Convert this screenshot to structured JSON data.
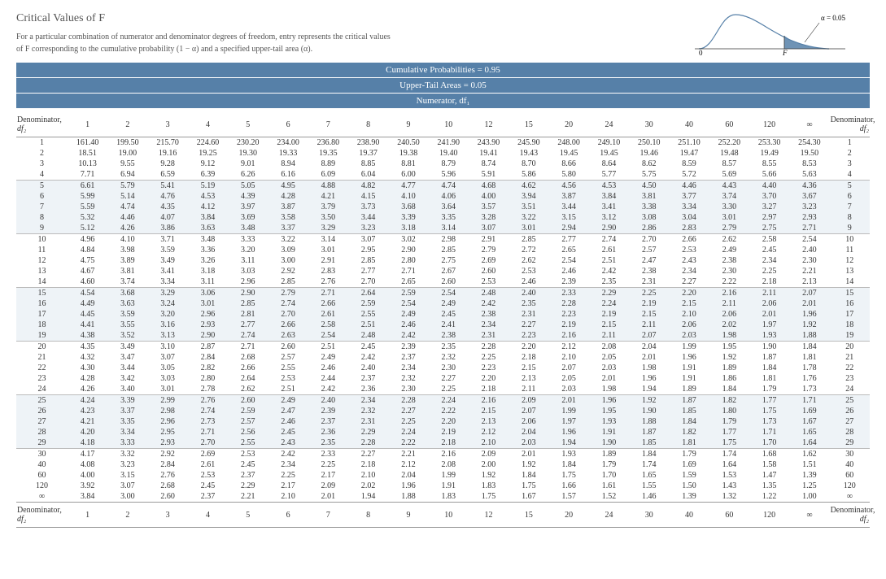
{
  "title": "Critical Values of F",
  "sub1": "For a particular combination of numerator and denominator degrees of freedom, entry represents the critical values",
  "sub2": "of F corresponding to the cumulative probability (1 − α) and a specified upper-tail area (α).",
  "alpha_lbl": "α = 0.05",
  "axis0": "0",
  "axisF": "F",
  "banner1": "Cumulative Probabilities = 0.95",
  "banner2": "Upper-Tail Areas = 0.05",
  "banner3": "Numerator, df₁",
  "denom_lbl": "Denominator,",
  "df2_lbl": "df₂",
  "cols": [
    "1",
    "2",
    "3",
    "4",
    "5",
    "6",
    "7",
    "8",
    "9",
    "10",
    "12",
    "15",
    "20",
    "24",
    "30",
    "40",
    "60",
    "120",
    "∞"
  ],
  "chart_data": {
    "type": "table",
    "title": "Critical Values of F, Cumulative Probabilities = 0.95, Upper-Tail Areas = 0.05",
    "xlabel": "Numerator df₁",
    "ylabel": "Denominator df₂",
    "col_headers": [
      "1",
      "2",
      "3",
      "4",
      "5",
      "6",
      "7",
      "8",
      "9",
      "10",
      "12",
      "15",
      "20",
      "24",
      "30",
      "40",
      "60",
      "120",
      "∞"
    ],
    "rows": [
      {
        "df2": "1",
        "v": [
          "161.40",
          "199.50",
          "215.70",
          "224.60",
          "230.20",
          "234.00",
          "236.80",
          "238.90",
          "240.50",
          "241.90",
          "243.90",
          "245.90",
          "248.00",
          "249.10",
          "250.10",
          "251.10",
          "252.20",
          "253.30",
          "254.30"
        ]
      },
      {
        "df2": "2",
        "v": [
          "18.51",
          "19.00",
          "19.16",
          "19.25",
          "19.30",
          "19.33",
          "19.35",
          "19.37",
          "19.38",
          "19.40",
          "19.41",
          "19.43",
          "19.45",
          "19.45",
          "19.46",
          "19.47",
          "19.48",
          "19.49",
          "19.50"
        ]
      },
      {
        "df2": "3",
        "v": [
          "10.13",
          "9.55",
          "9.28",
          "9.12",
          "9.01",
          "8.94",
          "8.89",
          "8.85",
          "8.81",
          "8.79",
          "8.74",
          "8.70",
          "8.66",
          "8.64",
          "8.62",
          "8.59",
          "8.57",
          "8.55",
          "8.53"
        ]
      },
      {
        "df2": "4",
        "v": [
          "7.71",
          "6.94",
          "6.59",
          "6.39",
          "6.26",
          "6.16",
          "6.09",
          "6.04",
          "6.00",
          "5.96",
          "5.91",
          "5.86",
          "5.80",
          "5.77",
          "5.75",
          "5.72",
          "5.69",
          "5.66",
          "5.63"
        ]
      },
      {
        "df2": "5",
        "v": [
          "6.61",
          "5.79",
          "5.41",
          "5.19",
          "5.05",
          "4.95",
          "4.88",
          "4.82",
          "4.77",
          "4.74",
          "4.68",
          "4.62",
          "4.56",
          "4.53",
          "4.50",
          "4.46",
          "4.43",
          "4.40",
          "4.36"
        ]
      },
      {
        "df2": "6",
        "v": [
          "5.99",
          "5.14",
          "4.76",
          "4.53",
          "4.39",
          "4.28",
          "4.21",
          "4.15",
          "4.10",
          "4.06",
          "4.00",
          "3.94",
          "3.87",
          "3.84",
          "3.81",
          "3.77",
          "3.74",
          "3.70",
          "3.67"
        ]
      },
      {
        "df2": "7",
        "v": [
          "5.59",
          "4.74",
          "4.35",
          "4.12",
          "3.97",
          "3.87",
          "3.79",
          "3.73",
          "3.68",
          "3.64",
          "3.57",
          "3.51",
          "3.44",
          "3.41",
          "3.38",
          "3.34",
          "3.30",
          "3.27",
          "3.23"
        ]
      },
      {
        "df2": "8",
        "v": [
          "5.32",
          "4.46",
          "4.07",
          "3.84",
          "3.69",
          "3.58",
          "3.50",
          "3.44",
          "3.39",
          "3.35",
          "3.28",
          "3.22",
          "3.15",
          "3.12",
          "3.08",
          "3.04",
          "3.01",
          "2.97",
          "2.93"
        ]
      },
      {
        "df2": "9",
        "v": [
          "5.12",
          "4.26",
          "3.86",
          "3.63",
          "3.48",
          "3.37",
          "3.29",
          "3.23",
          "3.18",
          "3.14",
          "3.07",
          "3.01",
          "2.94",
          "2.90",
          "2.86",
          "2.83",
          "2.79",
          "2.75",
          "2.71"
        ]
      },
      {
        "df2": "10",
        "v": [
          "4.96",
          "4.10",
          "3.71",
          "3.48",
          "3.33",
          "3.22",
          "3.14",
          "3.07",
          "3.02",
          "2.98",
          "2.91",
          "2.85",
          "2.77",
          "2.74",
          "2.70",
          "2.66",
          "2.62",
          "2.58",
          "2.54"
        ]
      },
      {
        "df2": "11",
        "v": [
          "4.84",
          "3.98",
          "3.59",
          "3.36",
          "3.20",
          "3.09",
          "3.01",
          "2.95",
          "2.90",
          "2.85",
          "2.79",
          "2.72",
          "2.65",
          "2.61",
          "2.57",
          "2.53",
          "2.49",
          "2.45",
          "2.40"
        ]
      },
      {
        "df2": "12",
        "v": [
          "4.75",
          "3.89",
          "3.49",
          "3.26",
          "3.11",
          "3.00",
          "2.91",
          "2.85",
          "2.80",
          "2.75",
          "2.69",
          "2.62",
          "2.54",
          "2.51",
          "2.47",
          "2.43",
          "2.38",
          "2.34",
          "2.30"
        ]
      },
      {
        "df2": "13",
        "v": [
          "4.67",
          "3.81",
          "3.41",
          "3.18",
          "3.03",
          "2.92",
          "2.83",
          "2.77",
          "2.71",
          "2.67",
          "2.60",
          "2.53",
          "2.46",
          "2.42",
          "2.38",
          "2.34",
          "2.30",
          "2.25",
          "2.21"
        ]
      },
      {
        "df2": "14",
        "v": [
          "4.60",
          "3.74",
          "3.34",
          "3.11",
          "2.96",
          "2.85",
          "2.76",
          "2.70",
          "2.65",
          "2.60",
          "2.53",
          "2.46",
          "2.39",
          "2.35",
          "2.31",
          "2.27",
          "2.22",
          "2.18",
          "2.13"
        ]
      },
      {
        "df2": "15",
        "v": [
          "4.54",
          "3.68",
          "3.29",
          "3.06",
          "2.90",
          "2.79",
          "2.71",
          "2.64",
          "2.59",
          "2.54",
          "2.48",
          "2.40",
          "2.33",
          "2.29",
          "2.25",
          "2.20",
          "2.16",
          "2.11",
          "2.07"
        ]
      },
      {
        "df2": "16",
        "v": [
          "4.49",
          "3.63",
          "3.24",
          "3.01",
          "2.85",
          "2.74",
          "2.66",
          "2.59",
          "2.54",
          "2.49",
          "2.42",
          "2.35",
          "2.28",
          "2.24",
          "2.19",
          "2.15",
          "2.11",
          "2.06",
          "2.01"
        ]
      },
      {
        "df2": "17",
        "v": [
          "4.45",
          "3.59",
          "3.20",
          "2.96",
          "2.81",
          "2.70",
          "2.61",
          "2.55",
          "2.49",
          "2.45",
          "2.38",
          "2.31",
          "2.23",
          "2.19",
          "2.15",
          "2.10",
          "2.06",
          "2.01",
          "1.96"
        ]
      },
      {
        "df2": "18",
        "v": [
          "4.41",
          "3.55",
          "3.16",
          "2.93",
          "2.77",
          "2.66",
          "2.58",
          "2.51",
          "2.46",
          "2.41",
          "2.34",
          "2.27",
          "2.19",
          "2.15",
          "2.11",
          "2.06",
          "2.02",
          "1.97",
          "1.92"
        ]
      },
      {
        "df2": "19",
        "v": [
          "4.38",
          "3.52",
          "3.13",
          "2.90",
          "2.74",
          "2.63",
          "2.54",
          "2.48",
          "2.42",
          "2.38",
          "2.31",
          "2.23",
          "2.16",
          "2.11",
          "2.07",
          "2.03",
          "1.98",
          "1.93",
          "1.88"
        ]
      },
      {
        "df2": "20",
        "v": [
          "4.35",
          "3.49",
          "3.10",
          "2.87",
          "2.71",
          "2.60",
          "2.51",
          "2.45",
          "2.39",
          "2.35",
          "2.28",
          "2.20",
          "2.12",
          "2.08",
          "2.04",
          "1.99",
          "1.95",
          "1.90",
          "1.84"
        ]
      },
      {
        "df2": "21",
        "v": [
          "4.32",
          "3.47",
          "3.07",
          "2.84",
          "2.68",
          "2.57",
          "2.49",
          "2.42",
          "2.37",
          "2.32",
          "2.25",
          "2.18",
          "2.10",
          "2.05",
          "2.01",
          "1.96",
          "1.92",
          "1.87",
          "1.81"
        ]
      },
      {
        "df2": "22",
        "v": [
          "4.30",
          "3.44",
          "3.05",
          "2.82",
          "2.66",
          "2.55",
          "2.46",
          "2.40",
          "2.34",
          "2.30",
          "2.23",
          "2.15",
          "2.07",
          "2.03",
          "1.98",
          "1.91",
          "1.89",
          "1.84",
          "1.78"
        ]
      },
      {
        "df2": "23",
        "v": [
          "4.28",
          "3.42",
          "3.03",
          "2.80",
          "2.64",
          "2.53",
          "2.44",
          "2.37",
          "2.32",
          "2.27",
          "2.20",
          "2.13",
          "2.05",
          "2.01",
          "1.96",
          "1.91",
          "1.86",
          "1.81",
          "1.76"
        ]
      },
      {
        "df2": "24",
        "v": [
          "4.26",
          "3.40",
          "3.01",
          "2.78",
          "2.62",
          "2.51",
          "2.42",
          "2.36",
          "2.30",
          "2.25",
          "2.18",
          "2.11",
          "2.03",
          "1.98",
          "1.94",
          "1.89",
          "1.84",
          "1.79",
          "1.73"
        ]
      },
      {
        "df2": "25",
        "v": [
          "4.24",
          "3.39",
          "2.99",
          "2.76",
          "2.60",
          "2.49",
          "2.40",
          "2.34",
          "2.28",
          "2.24",
          "2.16",
          "2.09",
          "2.01",
          "1.96",
          "1.92",
          "1.87",
          "1.82",
          "1.77",
          "1.71"
        ]
      },
      {
        "df2": "26",
        "v": [
          "4.23",
          "3.37",
          "2.98",
          "2.74",
          "2.59",
          "2.47",
          "2.39",
          "2.32",
          "2.27",
          "2.22",
          "2.15",
          "2.07",
          "1.99",
          "1.95",
          "1.90",
          "1.85",
          "1.80",
          "1.75",
          "1.69"
        ]
      },
      {
        "df2": "27",
        "v": [
          "4.21",
          "3.35",
          "2.96",
          "2.73",
          "2.57",
          "2.46",
          "2.37",
          "2.31",
          "2.25",
          "2.20",
          "2.13",
          "2.06",
          "1.97",
          "1.93",
          "1.88",
          "1.84",
          "1.79",
          "1.73",
          "1.67"
        ]
      },
      {
        "df2": "28",
        "v": [
          "4.20",
          "3.34",
          "2.95",
          "2.71",
          "2.56",
          "2.45",
          "2.36",
          "2.29",
          "2.24",
          "2.19",
          "2.12",
          "2.04",
          "1.96",
          "1.91",
          "1.87",
          "1.82",
          "1.77",
          "1.71",
          "1.65"
        ]
      },
      {
        "df2": "29",
        "v": [
          "4.18",
          "3.33",
          "2.93",
          "2.70",
          "2.55",
          "2.43",
          "2.35",
          "2.28",
          "2.22",
          "2.18",
          "2.10",
          "2.03",
          "1.94",
          "1.90",
          "1.85",
          "1.81",
          "1.75",
          "1.70",
          "1.64"
        ]
      },
      {
        "df2": "30",
        "v": [
          "4.17",
          "3.32",
          "2.92",
          "2.69",
          "2.53",
          "2.42",
          "2.33",
          "2.27",
          "2.21",
          "2.16",
          "2.09",
          "2.01",
          "1.93",
          "1.89",
          "1.84",
          "1.79",
          "1.74",
          "1.68",
          "1.62"
        ]
      },
      {
        "df2": "40",
        "v": [
          "4.08",
          "3.23",
          "2.84",
          "2.61",
          "2.45",
          "2.34",
          "2.25",
          "2.18",
          "2.12",
          "2.08",
          "2.00",
          "1.92",
          "1.84",
          "1.79",
          "1.74",
          "1.69",
          "1.64",
          "1.58",
          "1.51"
        ]
      },
      {
        "df2": "60",
        "v": [
          "4.00",
          "3.15",
          "2.76",
          "2.53",
          "2.37",
          "2.25",
          "2.17",
          "2.10",
          "2.04",
          "1.99",
          "1.92",
          "1.84",
          "1.75",
          "1.70",
          "1.65",
          "1.59",
          "1.53",
          "1.47",
          "1.39"
        ]
      },
      {
        "df2": "120",
        "v": [
          "3.92",
          "3.07",
          "2.68",
          "2.45",
          "2.29",
          "2.17",
          "2.09",
          "2.02",
          "1.96",
          "1.91",
          "1.83",
          "1.75",
          "1.66",
          "1.61",
          "1.55",
          "1.50",
          "1.43",
          "1.35",
          "1.25"
        ]
      },
      {
        "df2": "∞",
        "v": [
          "3.84",
          "3.00",
          "2.60",
          "2.37",
          "2.21",
          "2.10",
          "2.01",
          "1.94",
          "1.88",
          "1.83",
          "1.75",
          "1.67",
          "1.57",
          "1.52",
          "1.46",
          "1.39",
          "1.32",
          "1.22",
          "1.00"
        ]
      }
    ]
  }
}
